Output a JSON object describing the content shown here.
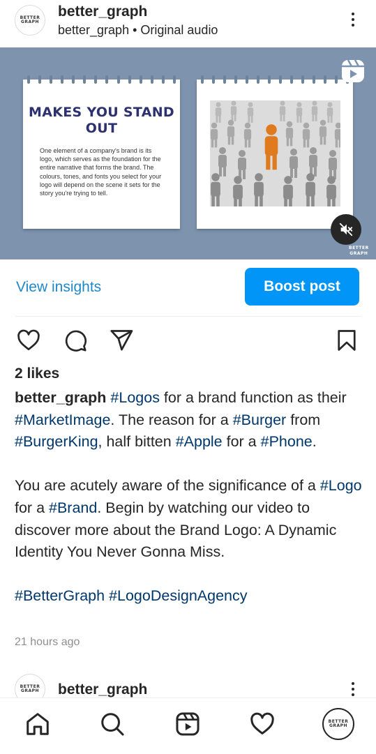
{
  "header": {
    "avatar_text_1": "BETTER",
    "avatar_text_2": "GRAPH",
    "username": "better_graph",
    "subline": "better_graph • Original audio"
  },
  "media": {
    "slide_title": "MAKES YOU STAND OUT",
    "slide_body": "One element of a company's brand is its logo, which serves as the foundation for the entire narrative that forms the brand. The colours, tones, and fonts you select for your logo will depend on the scene it sets for the story you're trying to tell.",
    "watermark_1": "BETTER",
    "watermark_2": "GRAPH",
    "icons": {
      "reels": "reels-icon",
      "mute": "speaker-muted-icon"
    },
    "colors": {
      "background": "#7d93ae",
      "figure_highlight": "#e07a1f"
    }
  },
  "insights": {
    "view_label": "View insights",
    "boost_label": "Boost post"
  },
  "actions": {
    "icons": [
      "heart-icon",
      "comment-icon",
      "share-icon",
      "bookmark-icon"
    ]
  },
  "likes": "2 likes",
  "caption": {
    "username": "better_graph",
    "p1": [
      {
        "t": "#Logos",
        "tag": true
      },
      {
        "t": " for a brand function as their ",
        "tag": false
      },
      {
        "t": "#MarketImage",
        "tag": true
      },
      {
        "t": ". The reason for a ",
        "tag": false
      },
      {
        "t": "#Burger",
        "tag": true
      },
      {
        "t": " from ",
        "tag": false
      },
      {
        "t": "#BurgerKing",
        "tag": true
      },
      {
        "t": ", half bitten ",
        "tag": false
      },
      {
        "t": "#Apple",
        "tag": true
      },
      {
        "t": " for a ",
        "tag": false
      },
      {
        "t": "#Phone",
        "tag": true
      },
      {
        "t": ".",
        "tag": false
      }
    ],
    "p2": [
      {
        "t": "You are acutely aware of the significance of a ",
        "tag": false
      },
      {
        "t": "#Logo",
        "tag": true
      },
      {
        "t": " for a ",
        "tag": false
      },
      {
        "t": "#Brand",
        "tag": true
      },
      {
        "t": ". Begin by watching our video to discover more about the Brand Logo: A Dynamic Identity You Never Gonna Miss.",
        "tag": false
      }
    ],
    "p3": [
      {
        "t": "#BetterGraph",
        "tag": true
      },
      {
        "t": " ",
        "tag": false
      },
      {
        "t": "#LogoDesignAgency",
        "tag": true
      }
    ]
  },
  "timestamp": "21 hours ago",
  "next_post": {
    "username": "better_graph",
    "avatar_text_1": "BETTER",
    "avatar_text_2": "GRAPH"
  },
  "tabbar": {
    "icons": [
      "home-icon",
      "search-icon",
      "reels-icon",
      "activity-heart-icon",
      "profile-avatar"
    ],
    "profile_text_1": "BETTER",
    "profile_text_2": "GRAPH"
  }
}
